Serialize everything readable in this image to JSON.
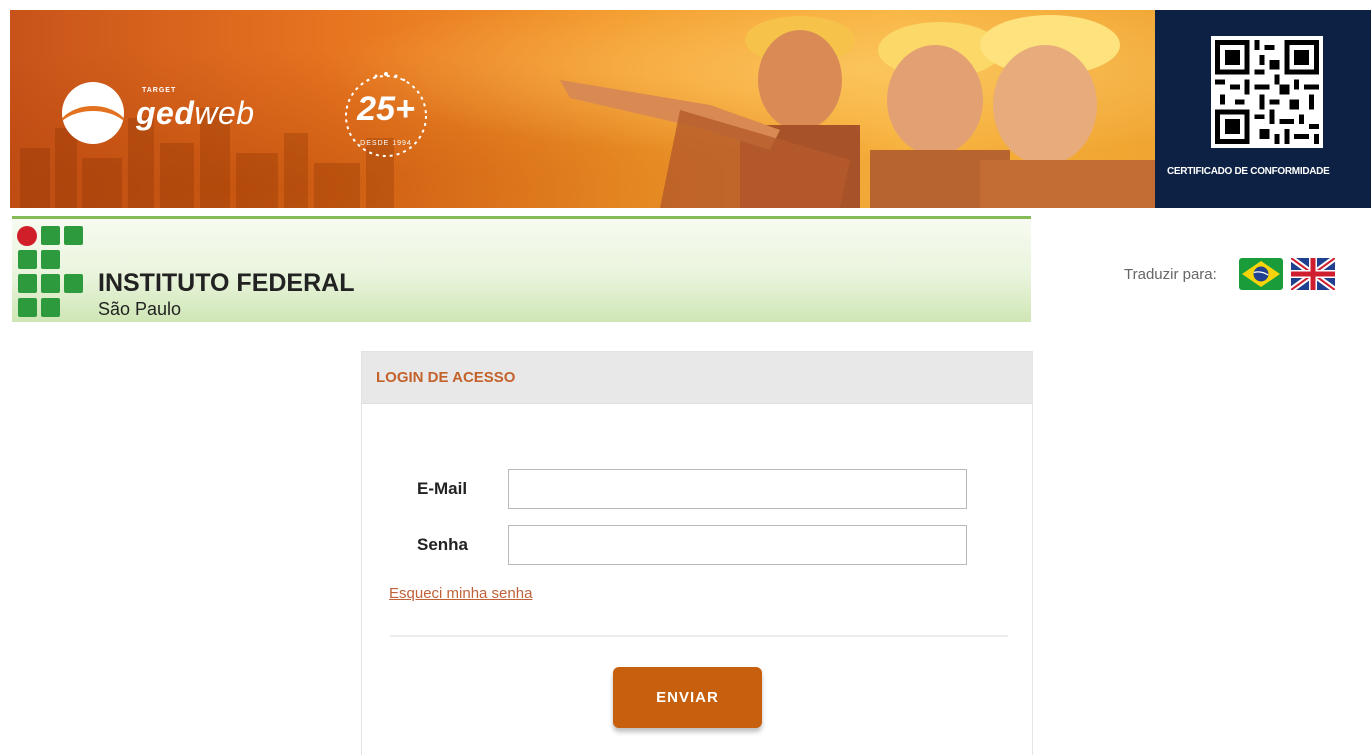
{
  "banner": {
    "brand_small": "TARGET",
    "brand_bold": "ged",
    "brand_light": "web",
    "anniversary_number": "25+",
    "anniversary_since": "DESDE 1994"
  },
  "certificate": {
    "label": "CERTIFICADO DE CONFORMIDADE"
  },
  "institute": {
    "title": "INSTITUTO FEDERAL",
    "subtitle": "São Paulo"
  },
  "translate": {
    "label": "Traduzir para:",
    "languages": [
      "pt-BR",
      "en-GB"
    ]
  },
  "login": {
    "title": "LOGIN DE ACESSO",
    "email_label": "E-Mail",
    "email_value": "",
    "password_label": "Senha",
    "password_value": "",
    "forgot_link": "Esqueci minha senha",
    "submit_label": "ENVIAR"
  },
  "colors": {
    "accent": "#c65f0e",
    "link": "#c0613a",
    "cert_bg": "#0d2144",
    "if_green": "#2e9a3e",
    "if_red": "#d11f2a"
  }
}
